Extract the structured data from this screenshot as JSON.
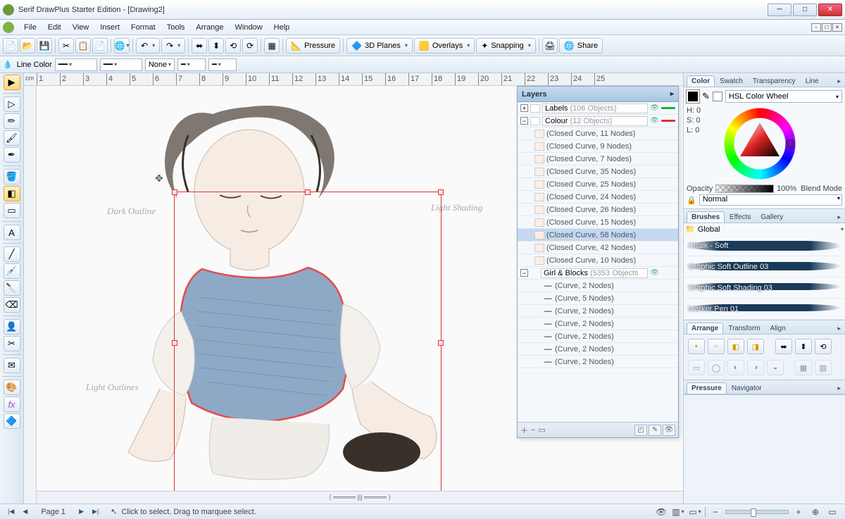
{
  "title": "Serif DrawPlus Starter Edition - [Drawing2]",
  "menu": [
    "File",
    "Edit",
    "View",
    "Insert",
    "Format",
    "Tools",
    "Arrange",
    "Window",
    "Help"
  ],
  "toolbar": {
    "pressure": "Pressure",
    "planes": "3D Planes",
    "overlays": "Overlays",
    "snapping": "Snapping",
    "share": "Share"
  },
  "optionsbar": {
    "line_color": "Line Color",
    "style_none": "None"
  },
  "ruler_unit": "cm",
  "ruler_ticks": [
    "1",
    "2",
    "3",
    "4",
    "5",
    "6",
    "7",
    "8",
    "9",
    "10",
    "11",
    "12",
    "13",
    "14",
    "15",
    "16",
    "17",
    "18",
    "19",
    "20",
    "21",
    "22",
    "23",
    "24",
    "25"
  ],
  "annotations": {
    "dark_outline": "Dark\nOutline",
    "light_shading": "Light\nShading",
    "light_outlines": "Light\nOutlines"
  },
  "layers_panel": {
    "title": "Layers",
    "groups": [
      {
        "name": "Labels",
        "count": "(106 Objects)"
      },
      {
        "name": "Colour",
        "count": "(12 Objects)"
      },
      {
        "name": "Girl & Blocks",
        "count": "(5353 Objects"
      }
    ],
    "colour_children": [
      "(Closed Curve, 11 Nodes)",
      "(Closed Curve, 9 Nodes)",
      "(Closed Curve, 7 Nodes)",
      "(Closed Curve, 35 Nodes)",
      "(Closed Curve, 25 Nodes)",
      "(Closed Curve, 24 Nodes)",
      "(Closed Curve, 26 Nodes)",
      "(Closed Curve, 15 Nodes)",
      "(Closed Curve, 58 Nodes)",
      "(Closed Curve, 42 Nodes)",
      "(Closed Curve, 10 Nodes)"
    ],
    "girl_children": [
      "(Curve, 2 Nodes)",
      "(Curve, 5 Nodes)",
      "(Curve, 2 Nodes)",
      "(Curve, 2 Nodes)",
      "(Curve, 2 Nodes)",
      "(Curve, 2 Nodes)",
      "(Curve, 2 Nodes)"
    ],
    "selected_index": 8
  },
  "right": {
    "color_tabs": [
      "Color",
      "Swatch",
      "Transparency",
      "Line"
    ],
    "color_mode": "HSL Color Wheel",
    "hsl": {
      "h": "H: 0",
      "s": "S: 0",
      "l": "L: 0"
    },
    "opacity_label": "Opacity",
    "opacity_value": "100%",
    "blend_label": "Blend Mode",
    "blend_value": "Normal",
    "brush_tabs": [
      "Brushes",
      "Effects",
      "Gallery"
    ],
    "brush_folder": "Global",
    "brushes": [
      "Chalk - Soft",
      "Graphic Soft Outline 03",
      "Graphic Soft Shading 03",
      "Marker Pen 01"
    ],
    "arrange_tabs": [
      "Arrange",
      "Transform",
      "Align"
    ],
    "pressure_tabs": [
      "Pressure",
      "Navigator"
    ]
  },
  "statusbar": {
    "page": "Page 1",
    "hint": "Click to select. Drag to marquee select."
  }
}
